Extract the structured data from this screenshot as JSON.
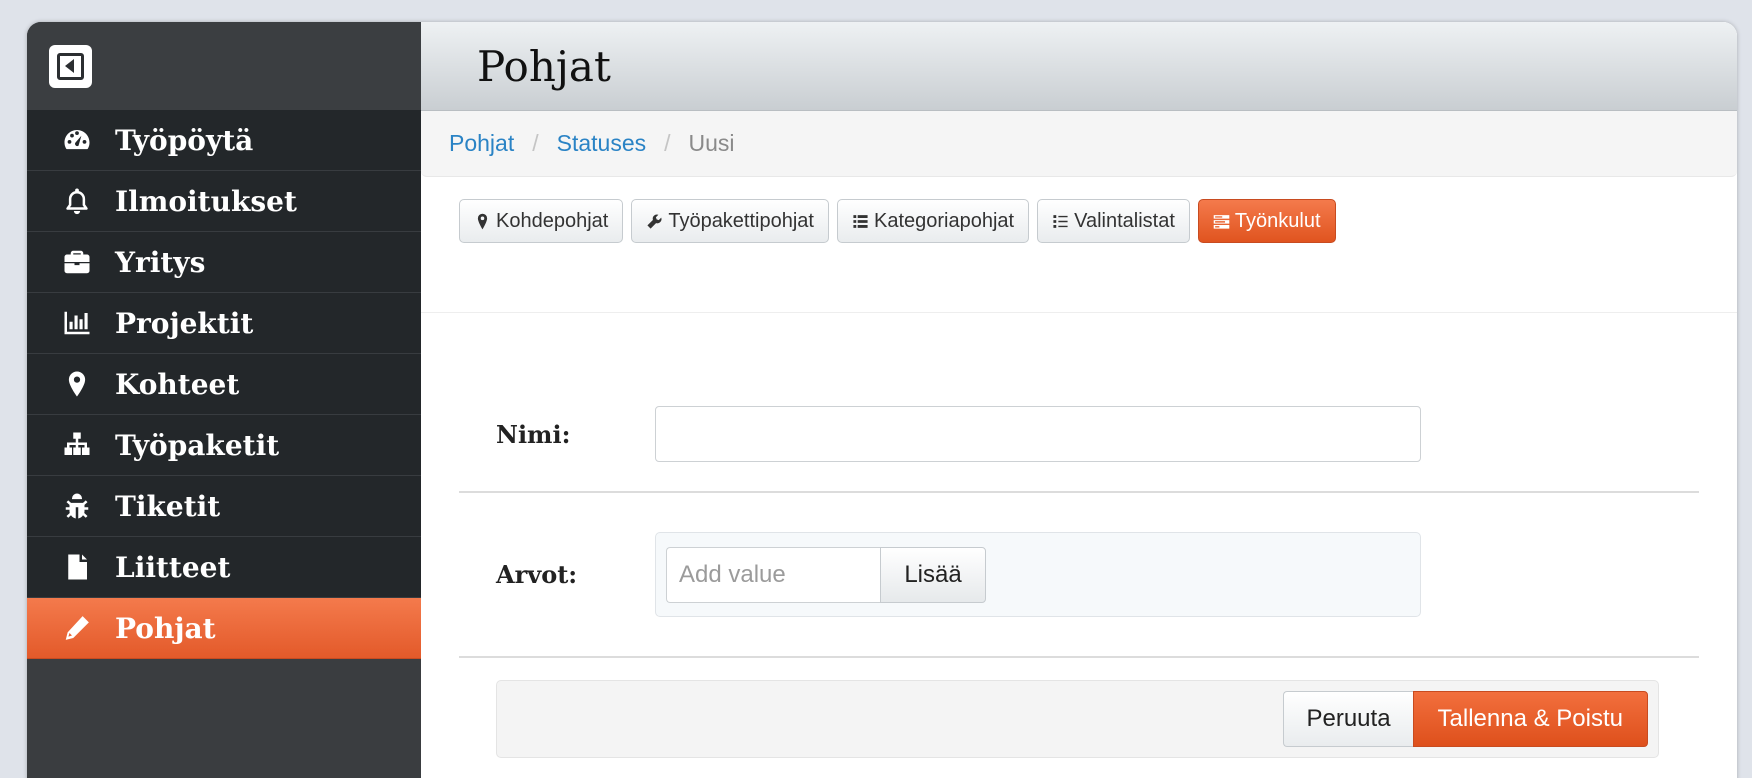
{
  "colors": {
    "accent": "#e85a26",
    "sidebar_bg": "#23272a",
    "link": "#2a83c5"
  },
  "sidebar": {
    "back_icon": "back-icon",
    "items": [
      {
        "label": "Työpöytä",
        "icon": "dashboard-icon",
        "active": false
      },
      {
        "label": "Ilmoitukset",
        "icon": "bell-icon",
        "active": false
      },
      {
        "label": "Yritys",
        "icon": "briefcase-icon",
        "active": false
      },
      {
        "label": "Projektit",
        "icon": "bar-chart-icon",
        "active": false
      },
      {
        "label": "Kohteet",
        "icon": "map-marker-icon",
        "active": false
      },
      {
        "label": "Työpaketit",
        "icon": "sitemap-icon",
        "active": false
      },
      {
        "label": "Tiketit",
        "icon": "bug-icon",
        "active": false
      },
      {
        "label": "Liitteet",
        "icon": "file-icon",
        "active": false
      },
      {
        "label": "Pohjat",
        "icon": "pencil-icon",
        "active": true
      }
    ]
  },
  "header": {
    "title": "Pohjat"
  },
  "breadcrumb": {
    "items": [
      "Pohjat",
      "Statuses"
    ],
    "current": "Uusi"
  },
  "toolbar": {
    "buttons": [
      {
        "label": "Kohdepohjat",
        "icon": "map-marker-icon"
      },
      {
        "label": "Työpakettipohjat",
        "icon": "wrench-icon"
      },
      {
        "label": "Kategoriapohjat",
        "icon": "list-icon"
      },
      {
        "label": "Valintalistat",
        "icon": "list-ul-icon"
      },
      {
        "label": "Työnkulut",
        "icon": "tasks-icon",
        "active": true
      }
    ]
  },
  "form": {
    "name_label": "Nimi:",
    "name_value": "",
    "values_label": "Arvot:",
    "value_placeholder": "Add value",
    "add_label": "Lisää",
    "cancel_label": "Peruuta",
    "save_label": "Tallenna & Poistu"
  }
}
